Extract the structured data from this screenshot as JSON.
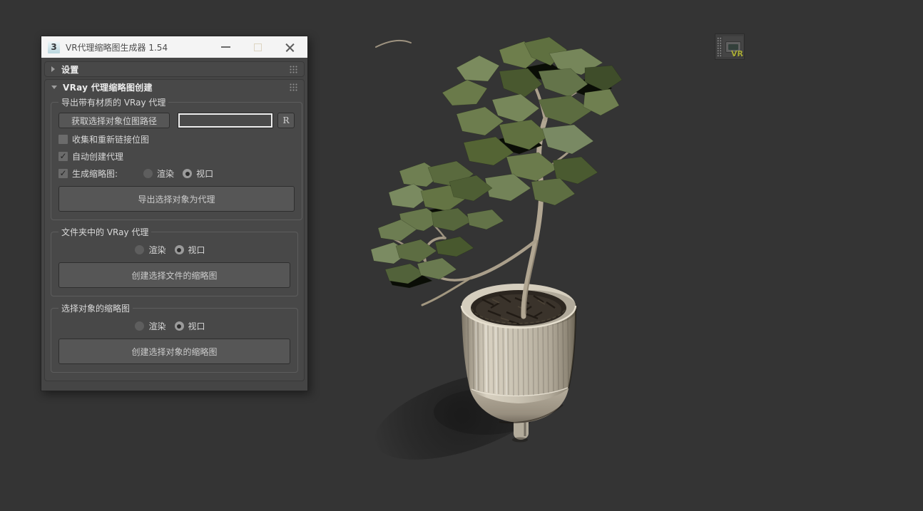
{
  "colors": {
    "viewport_bg": "#343434",
    "dialog_bg": "#454545",
    "titlebar_bg": "#f4f4f4",
    "rollout_bg": "#484848",
    "button_bg": "#565656",
    "leaf_green": "#6e7e4c",
    "pot_beige": "#cfc8b8",
    "soil_brown": "#37302a",
    "vr_olive": "#a9ab36"
  },
  "window": {
    "icon_label": "3",
    "title": "VR代理缩略图生成器 1.54"
  },
  "rollouts": {
    "settings": {
      "label": "设置",
      "collapsed": true
    },
    "create": {
      "label": "VRay 代理缩略图创建",
      "collapsed": false
    }
  },
  "export_group": {
    "title": "导出带有材质的 VRay 代理",
    "get_path_button": "获取选择对象位图路径",
    "path_value": "",
    "reset_button": "R",
    "collect_checkbox": {
      "label": "收集和重新链接位图",
      "checked": false
    },
    "auto_checkbox": {
      "label": "自动创建代理",
      "checked": true
    },
    "thumb_checkbox": {
      "label": "生成缩略图:",
      "checked": true
    },
    "render_radio": {
      "label": "渲染",
      "selected": false
    },
    "viewport_radio": {
      "label": "视口",
      "selected": true
    },
    "export_button": "导出选择对象为代理"
  },
  "folder_group": {
    "title": "文件夹中的 VRay 代理",
    "render_radio": {
      "label": "渲染",
      "selected": false
    },
    "viewport_radio": {
      "label": "视口",
      "selected": true
    },
    "create_button": "创建选择文件的缩略图"
  },
  "object_group": {
    "title": "选择对象的缩略图",
    "render_radio": {
      "label": "渲染",
      "selected": false
    },
    "viewport_radio": {
      "label": "视口",
      "selected": true
    },
    "create_button": "创建选择对象的缩略图"
  },
  "toolbar": {
    "vr_label": "VR"
  }
}
